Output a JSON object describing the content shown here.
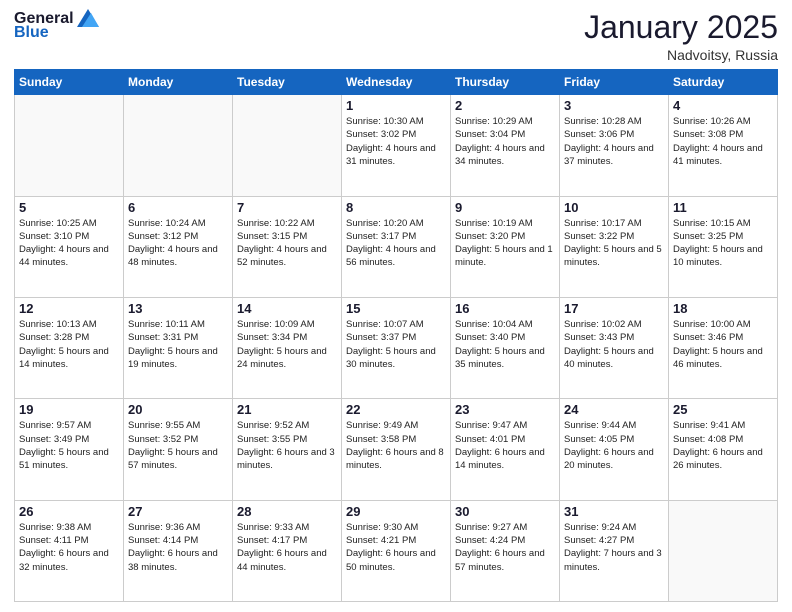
{
  "header": {
    "logo_general": "General",
    "logo_blue": "Blue",
    "month": "January 2025",
    "location": "Nadvoitsy, Russia"
  },
  "weekdays": [
    "Sunday",
    "Monday",
    "Tuesday",
    "Wednesday",
    "Thursday",
    "Friday",
    "Saturday"
  ],
  "weeks": [
    [
      {
        "day": "",
        "info": ""
      },
      {
        "day": "",
        "info": ""
      },
      {
        "day": "",
        "info": ""
      },
      {
        "day": "1",
        "info": "Sunrise: 10:30 AM\nSunset: 3:02 PM\nDaylight: 4 hours\nand 31 minutes."
      },
      {
        "day": "2",
        "info": "Sunrise: 10:29 AM\nSunset: 3:04 PM\nDaylight: 4 hours\nand 34 minutes."
      },
      {
        "day": "3",
        "info": "Sunrise: 10:28 AM\nSunset: 3:06 PM\nDaylight: 4 hours\nand 37 minutes."
      },
      {
        "day": "4",
        "info": "Sunrise: 10:26 AM\nSunset: 3:08 PM\nDaylight: 4 hours\nand 41 minutes."
      }
    ],
    [
      {
        "day": "5",
        "info": "Sunrise: 10:25 AM\nSunset: 3:10 PM\nDaylight: 4 hours\nand 44 minutes."
      },
      {
        "day": "6",
        "info": "Sunrise: 10:24 AM\nSunset: 3:12 PM\nDaylight: 4 hours\nand 48 minutes."
      },
      {
        "day": "7",
        "info": "Sunrise: 10:22 AM\nSunset: 3:15 PM\nDaylight: 4 hours\nand 52 minutes."
      },
      {
        "day": "8",
        "info": "Sunrise: 10:20 AM\nSunset: 3:17 PM\nDaylight: 4 hours\nand 56 minutes."
      },
      {
        "day": "9",
        "info": "Sunrise: 10:19 AM\nSunset: 3:20 PM\nDaylight: 5 hours\nand 1 minute."
      },
      {
        "day": "10",
        "info": "Sunrise: 10:17 AM\nSunset: 3:22 PM\nDaylight: 5 hours\nand 5 minutes."
      },
      {
        "day": "11",
        "info": "Sunrise: 10:15 AM\nSunset: 3:25 PM\nDaylight: 5 hours\nand 10 minutes."
      }
    ],
    [
      {
        "day": "12",
        "info": "Sunrise: 10:13 AM\nSunset: 3:28 PM\nDaylight: 5 hours\nand 14 minutes."
      },
      {
        "day": "13",
        "info": "Sunrise: 10:11 AM\nSunset: 3:31 PM\nDaylight: 5 hours\nand 19 minutes."
      },
      {
        "day": "14",
        "info": "Sunrise: 10:09 AM\nSunset: 3:34 PM\nDaylight: 5 hours\nand 24 minutes."
      },
      {
        "day": "15",
        "info": "Sunrise: 10:07 AM\nSunset: 3:37 PM\nDaylight: 5 hours\nand 30 minutes."
      },
      {
        "day": "16",
        "info": "Sunrise: 10:04 AM\nSunset: 3:40 PM\nDaylight: 5 hours\nand 35 minutes."
      },
      {
        "day": "17",
        "info": "Sunrise: 10:02 AM\nSunset: 3:43 PM\nDaylight: 5 hours\nand 40 minutes."
      },
      {
        "day": "18",
        "info": "Sunrise: 10:00 AM\nSunset: 3:46 PM\nDaylight: 5 hours\nand 46 minutes."
      }
    ],
    [
      {
        "day": "19",
        "info": "Sunrise: 9:57 AM\nSunset: 3:49 PM\nDaylight: 5 hours\nand 51 minutes."
      },
      {
        "day": "20",
        "info": "Sunrise: 9:55 AM\nSunset: 3:52 PM\nDaylight: 5 hours\nand 57 minutes."
      },
      {
        "day": "21",
        "info": "Sunrise: 9:52 AM\nSunset: 3:55 PM\nDaylight: 6 hours\nand 3 minutes."
      },
      {
        "day": "22",
        "info": "Sunrise: 9:49 AM\nSunset: 3:58 PM\nDaylight: 6 hours\nand 8 minutes."
      },
      {
        "day": "23",
        "info": "Sunrise: 9:47 AM\nSunset: 4:01 PM\nDaylight: 6 hours\nand 14 minutes."
      },
      {
        "day": "24",
        "info": "Sunrise: 9:44 AM\nSunset: 4:05 PM\nDaylight: 6 hours\nand 20 minutes."
      },
      {
        "day": "25",
        "info": "Sunrise: 9:41 AM\nSunset: 4:08 PM\nDaylight: 6 hours\nand 26 minutes."
      }
    ],
    [
      {
        "day": "26",
        "info": "Sunrise: 9:38 AM\nSunset: 4:11 PM\nDaylight: 6 hours\nand 32 minutes."
      },
      {
        "day": "27",
        "info": "Sunrise: 9:36 AM\nSunset: 4:14 PM\nDaylight: 6 hours\nand 38 minutes."
      },
      {
        "day": "28",
        "info": "Sunrise: 9:33 AM\nSunset: 4:17 PM\nDaylight: 6 hours\nand 44 minutes."
      },
      {
        "day": "29",
        "info": "Sunrise: 9:30 AM\nSunset: 4:21 PM\nDaylight: 6 hours\nand 50 minutes."
      },
      {
        "day": "30",
        "info": "Sunrise: 9:27 AM\nSunset: 4:24 PM\nDaylight: 6 hours\nand 57 minutes."
      },
      {
        "day": "31",
        "info": "Sunrise: 9:24 AM\nSunset: 4:27 PM\nDaylight: 7 hours\nand 3 minutes."
      },
      {
        "day": "",
        "info": ""
      }
    ]
  ]
}
